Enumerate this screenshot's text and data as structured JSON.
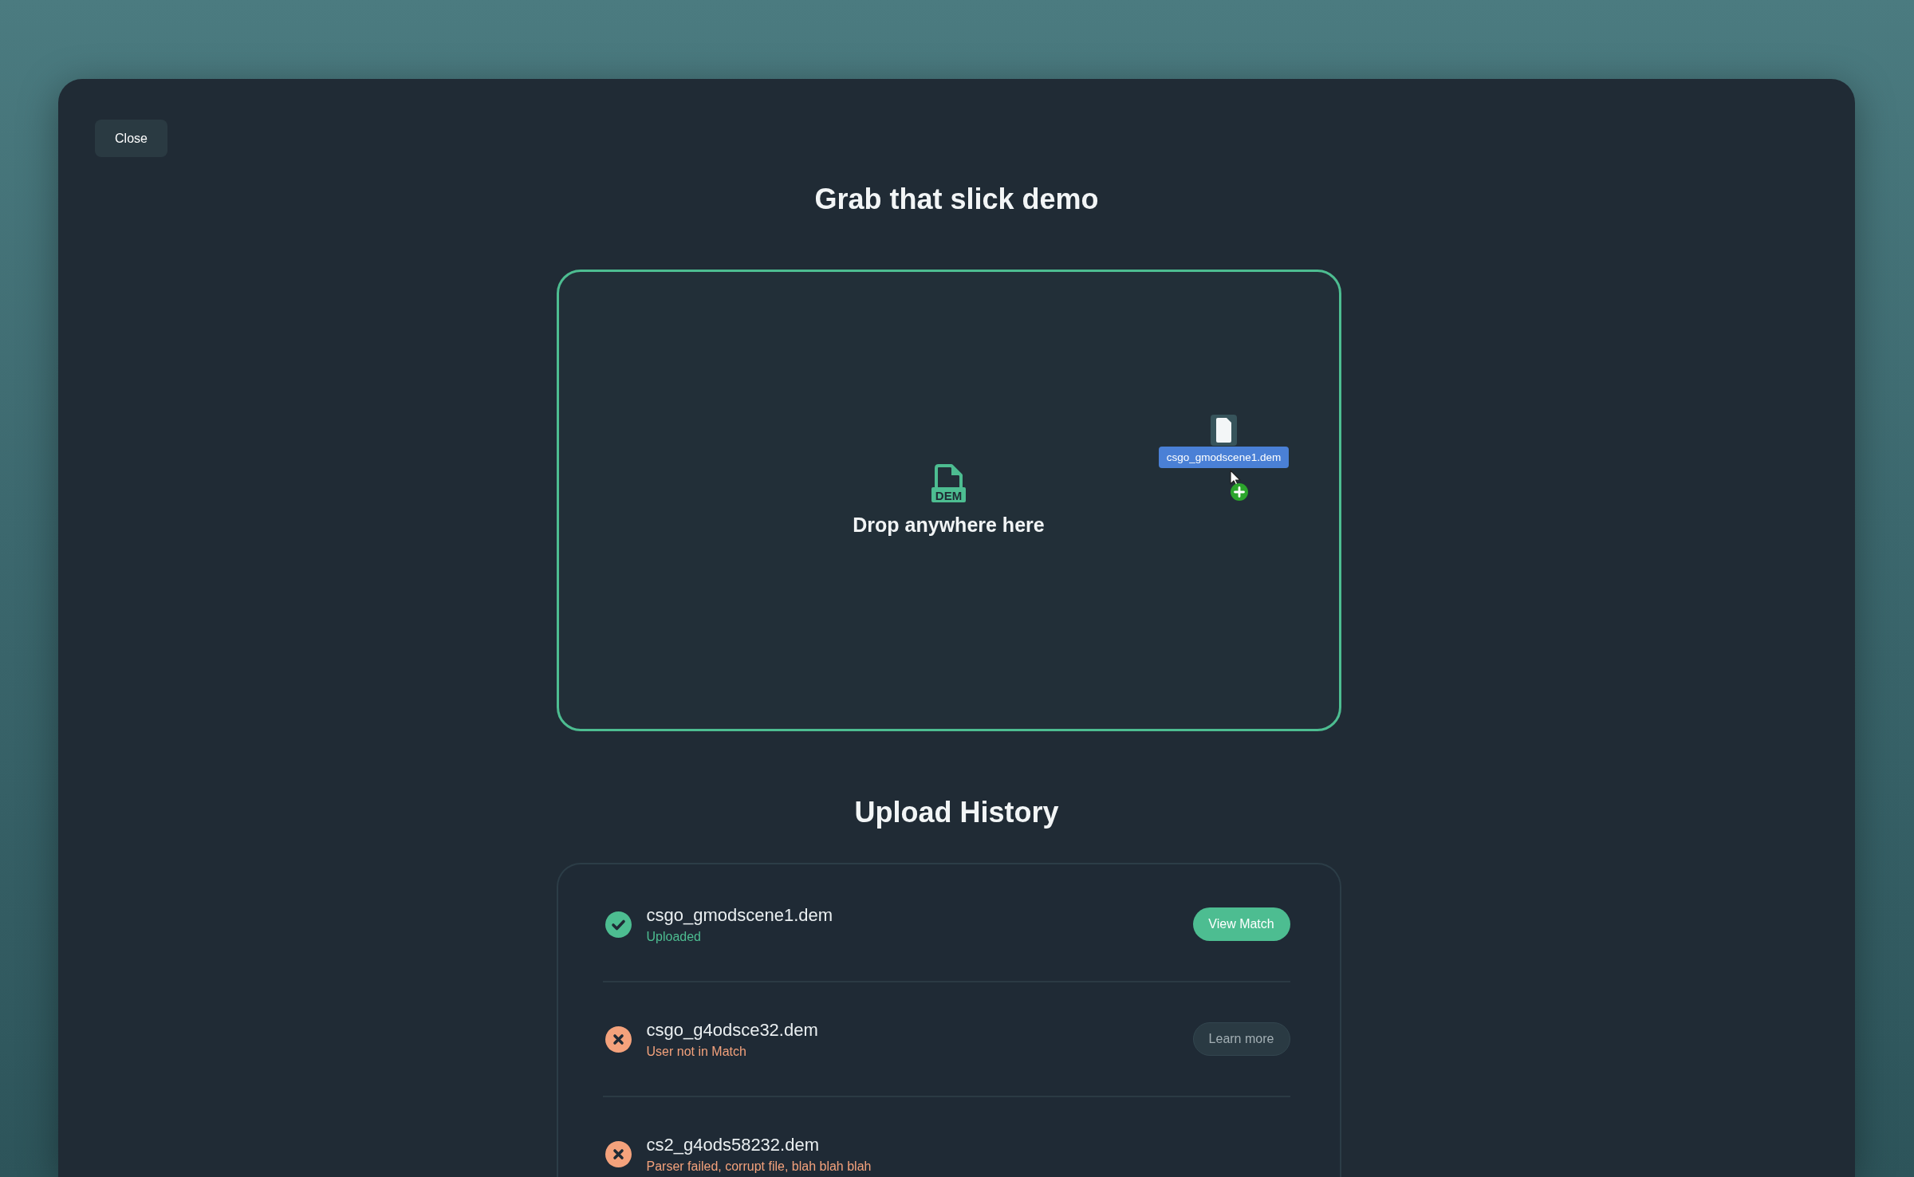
{
  "close_button": "Close",
  "title": "Grab that slick demo",
  "drop_zone": {
    "file_badge": "DEM",
    "prompt": "Drop anywhere here",
    "dragged_file": {
      "name": "csgo_gmodscene1.dem"
    }
  },
  "upload_history": {
    "title": "Upload History",
    "items": [
      {
        "kind": "success",
        "file_name": "csgo_gmodscene1.dem",
        "status": "Uploaded",
        "action": {
          "kind": "primary",
          "label": "View Match"
        }
      },
      {
        "kind": "error",
        "file_name": "csgo_g4odsce32.dem",
        "status": "User not in Match",
        "action": {
          "kind": "secondary",
          "label": "Learn more"
        }
      },
      {
        "kind": "error",
        "file_name": "cs2_g4ods58232.dem",
        "status": "Parser failed, corrupt file, blah blah blah"
      }
    ]
  }
}
